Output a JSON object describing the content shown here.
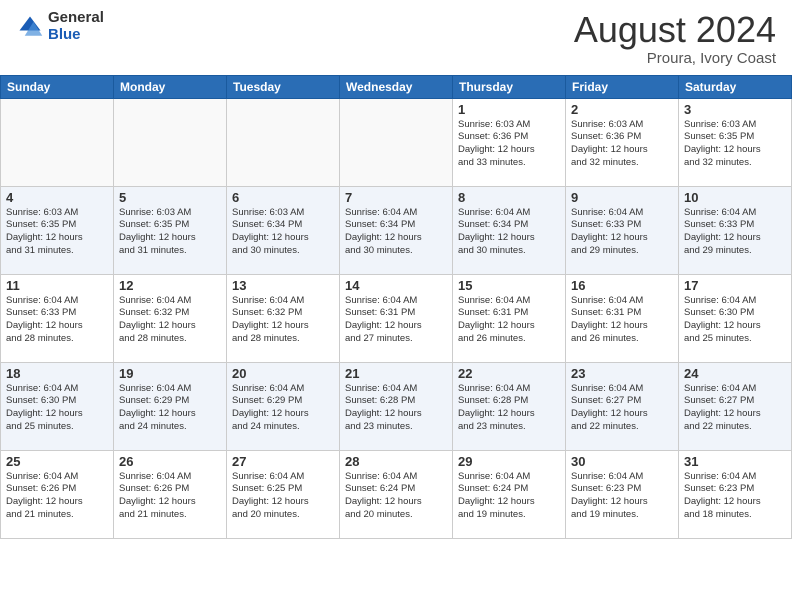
{
  "header": {
    "logo_general": "General",
    "logo_blue": "Blue",
    "month_year": "August 2024",
    "location": "Proura, Ivory Coast"
  },
  "weekdays": [
    "Sunday",
    "Monday",
    "Tuesday",
    "Wednesday",
    "Thursday",
    "Friday",
    "Saturday"
  ],
  "weeks": [
    [
      {
        "day": "",
        "info": ""
      },
      {
        "day": "",
        "info": ""
      },
      {
        "day": "",
        "info": ""
      },
      {
        "day": "",
        "info": ""
      },
      {
        "day": "1",
        "info": "Sunrise: 6:03 AM\nSunset: 6:36 PM\nDaylight: 12 hours\nand 33 minutes."
      },
      {
        "day": "2",
        "info": "Sunrise: 6:03 AM\nSunset: 6:36 PM\nDaylight: 12 hours\nand 32 minutes."
      },
      {
        "day": "3",
        "info": "Sunrise: 6:03 AM\nSunset: 6:35 PM\nDaylight: 12 hours\nand 32 minutes."
      }
    ],
    [
      {
        "day": "4",
        "info": "Sunrise: 6:03 AM\nSunset: 6:35 PM\nDaylight: 12 hours\nand 31 minutes."
      },
      {
        "day": "5",
        "info": "Sunrise: 6:03 AM\nSunset: 6:35 PM\nDaylight: 12 hours\nand 31 minutes."
      },
      {
        "day": "6",
        "info": "Sunrise: 6:03 AM\nSunset: 6:34 PM\nDaylight: 12 hours\nand 30 minutes."
      },
      {
        "day": "7",
        "info": "Sunrise: 6:04 AM\nSunset: 6:34 PM\nDaylight: 12 hours\nand 30 minutes."
      },
      {
        "day": "8",
        "info": "Sunrise: 6:04 AM\nSunset: 6:34 PM\nDaylight: 12 hours\nand 30 minutes."
      },
      {
        "day": "9",
        "info": "Sunrise: 6:04 AM\nSunset: 6:33 PM\nDaylight: 12 hours\nand 29 minutes."
      },
      {
        "day": "10",
        "info": "Sunrise: 6:04 AM\nSunset: 6:33 PM\nDaylight: 12 hours\nand 29 minutes."
      }
    ],
    [
      {
        "day": "11",
        "info": "Sunrise: 6:04 AM\nSunset: 6:33 PM\nDaylight: 12 hours\nand 28 minutes."
      },
      {
        "day": "12",
        "info": "Sunrise: 6:04 AM\nSunset: 6:32 PM\nDaylight: 12 hours\nand 28 minutes."
      },
      {
        "day": "13",
        "info": "Sunrise: 6:04 AM\nSunset: 6:32 PM\nDaylight: 12 hours\nand 28 minutes."
      },
      {
        "day": "14",
        "info": "Sunrise: 6:04 AM\nSunset: 6:31 PM\nDaylight: 12 hours\nand 27 minutes."
      },
      {
        "day": "15",
        "info": "Sunrise: 6:04 AM\nSunset: 6:31 PM\nDaylight: 12 hours\nand 26 minutes."
      },
      {
        "day": "16",
        "info": "Sunrise: 6:04 AM\nSunset: 6:31 PM\nDaylight: 12 hours\nand 26 minutes."
      },
      {
        "day": "17",
        "info": "Sunrise: 6:04 AM\nSunset: 6:30 PM\nDaylight: 12 hours\nand 25 minutes."
      }
    ],
    [
      {
        "day": "18",
        "info": "Sunrise: 6:04 AM\nSunset: 6:30 PM\nDaylight: 12 hours\nand 25 minutes."
      },
      {
        "day": "19",
        "info": "Sunrise: 6:04 AM\nSunset: 6:29 PM\nDaylight: 12 hours\nand 24 minutes."
      },
      {
        "day": "20",
        "info": "Sunrise: 6:04 AM\nSunset: 6:29 PM\nDaylight: 12 hours\nand 24 minutes."
      },
      {
        "day": "21",
        "info": "Sunrise: 6:04 AM\nSunset: 6:28 PM\nDaylight: 12 hours\nand 23 minutes."
      },
      {
        "day": "22",
        "info": "Sunrise: 6:04 AM\nSunset: 6:28 PM\nDaylight: 12 hours\nand 23 minutes."
      },
      {
        "day": "23",
        "info": "Sunrise: 6:04 AM\nSunset: 6:27 PM\nDaylight: 12 hours\nand 22 minutes."
      },
      {
        "day": "24",
        "info": "Sunrise: 6:04 AM\nSunset: 6:27 PM\nDaylight: 12 hours\nand 22 minutes."
      }
    ],
    [
      {
        "day": "25",
        "info": "Sunrise: 6:04 AM\nSunset: 6:26 PM\nDaylight: 12 hours\nand 21 minutes."
      },
      {
        "day": "26",
        "info": "Sunrise: 6:04 AM\nSunset: 6:26 PM\nDaylight: 12 hours\nand 21 minutes."
      },
      {
        "day": "27",
        "info": "Sunrise: 6:04 AM\nSunset: 6:25 PM\nDaylight: 12 hours\nand 20 minutes."
      },
      {
        "day": "28",
        "info": "Sunrise: 6:04 AM\nSunset: 6:24 PM\nDaylight: 12 hours\nand 20 minutes."
      },
      {
        "day": "29",
        "info": "Sunrise: 6:04 AM\nSunset: 6:24 PM\nDaylight: 12 hours\nand 19 minutes."
      },
      {
        "day": "30",
        "info": "Sunrise: 6:04 AM\nSunset: 6:23 PM\nDaylight: 12 hours\nand 19 minutes."
      },
      {
        "day": "31",
        "info": "Sunrise: 6:04 AM\nSunset: 6:23 PM\nDaylight: 12 hours\nand 18 minutes."
      }
    ]
  ]
}
